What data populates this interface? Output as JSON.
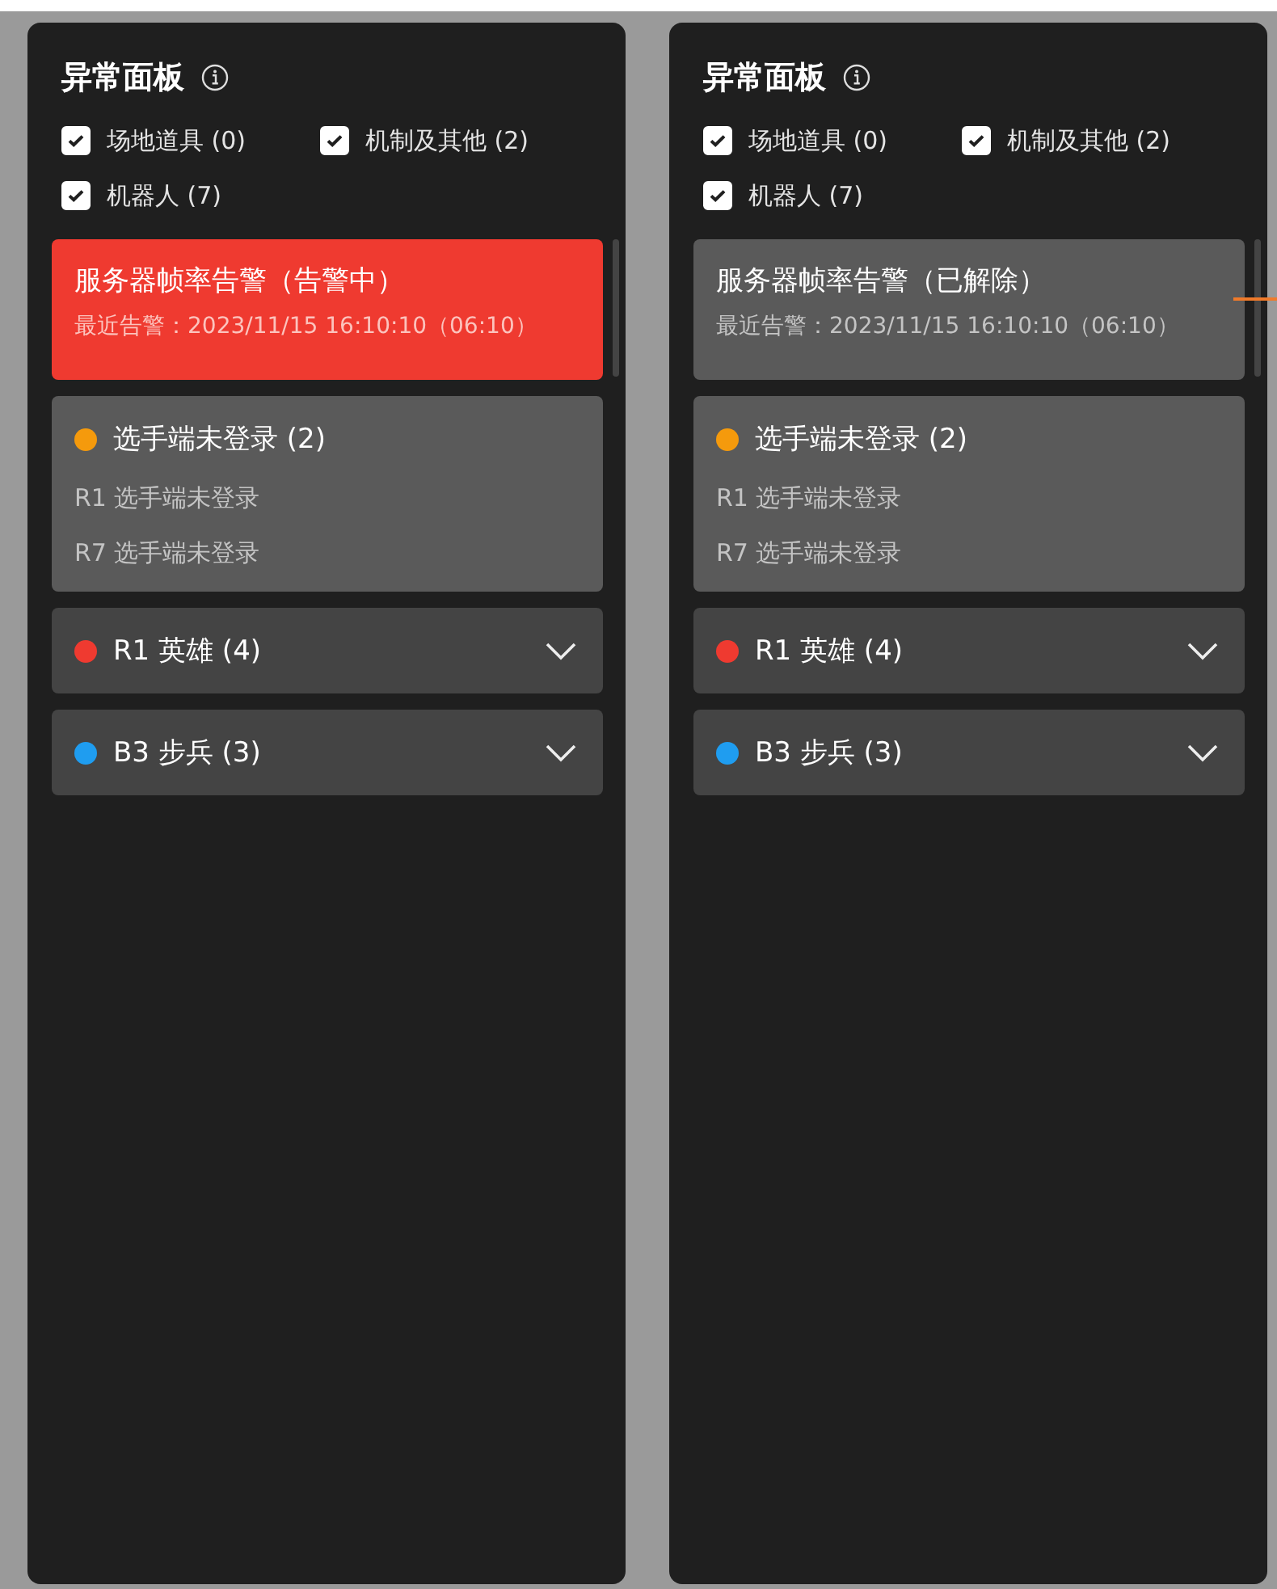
{
  "panels": [
    {
      "title": "异常面板",
      "leader_line": false,
      "filters": [
        {
          "label": "场地道具 (0)",
          "checked": true
        },
        {
          "label": "机制及其他 (2)",
          "checked": true
        },
        {
          "label": "机器人 (7)",
          "checked": true
        }
      ],
      "alerts": [
        {
          "kind": "server",
          "active": true,
          "title": "服务器帧率告警（告警中）",
          "detail": "最近告警：2023/11/15 16:10:10（06:10）"
        },
        {
          "kind": "group",
          "title": "选手端未登录 (2)",
          "color": "#f59a0c",
          "expanded": true,
          "items": [
            "R1 选手端未登录",
            "R7 选手端未登录"
          ]
        },
        {
          "kind": "group",
          "title": "R1 英雄 (4)",
          "color": "#ef3a30",
          "expanded": false
        },
        {
          "kind": "group",
          "title": "B3 步兵 (3)",
          "color": "#1f9df0",
          "expanded": false
        }
      ]
    },
    {
      "title": "异常面板",
      "leader_line": true,
      "filters": [
        {
          "label": "场地道具 (0)",
          "checked": true
        },
        {
          "label": "机制及其他 (2)",
          "checked": true
        },
        {
          "label": "机器人 (7)",
          "checked": true
        }
      ],
      "alerts": [
        {
          "kind": "server",
          "active": false,
          "title": "服务器帧率告警（已解除）",
          "detail": "最近告警：2023/11/15 16:10:10（06:10）"
        },
        {
          "kind": "group",
          "title": "选手端未登录 (2)",
          "color": "#f59a0c",
          "expanded": true,
          "items": [
            "R1 选手端未登录",
            "R7 选手端未登录"
          ]
        },
        {
          "kind": "group",
          "title": "R1 英雄 (4)",
          "color": "#ef3a30",
          "expanded": false
        },
        {
          "kind": "group",
          "title": "B3 步兵 (3)",
          "color": "#1f9df0",
          "expanded": false
        }
      ]
    }
  ]
}
